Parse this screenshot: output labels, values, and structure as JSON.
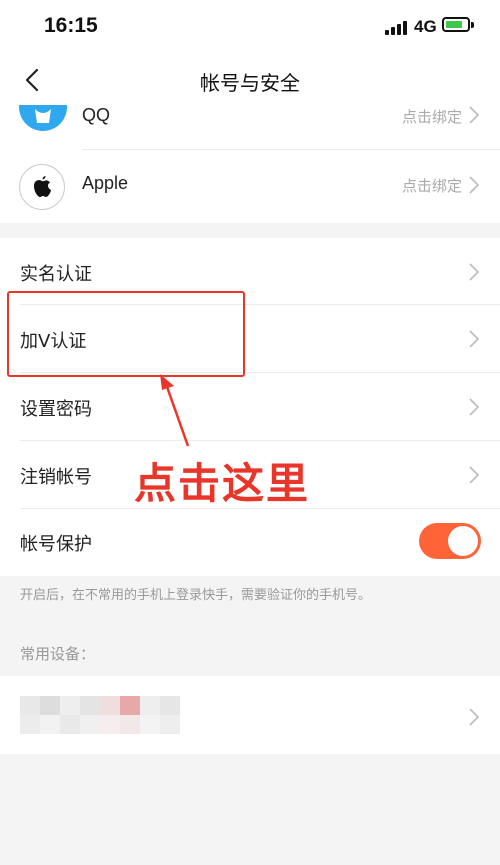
{
  "status_bar": {
    "time": "16:15",
    "network": "4G"
  },
  "nav": {
    "title": "帐号与安全"
  },
  "bindings": [
    {
      "label": "QQ",
      "action": "点击绑定"
    },
    {
      "label": "Apple",
      "action": "点击绑定"
    }
  ],
  "settings": [
    {
      "label": "实名认证"
    },
    {
      "label": "加V认证"
    },
    {
      "label": "设置密码"
    },
    {
      "label": "注销帐号"
    }
  ],
  "protection": {
    "label": "帐号保护",
    "enabled": true,
    "hint": "开启后，在不常用的手机上登录快手，需要验证你的手机号。"
  },
  "devices": {
    "header": "常用设备："
  },
  "annotation": {
    "text": "点击这里"
  },
  "colors": {
    "accent": "#fe6437",
    "annotation": "#e8362b",
    "qq": "#2fa8f0"
  }
}
